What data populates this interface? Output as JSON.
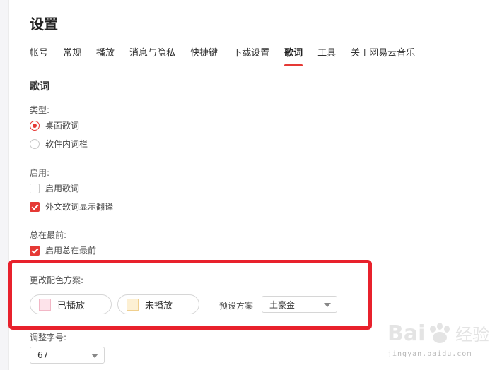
{
  "settings": {
    "title": "设置",
    "tabs": [
      {
        "label": "帐号"
      },
      {
        "label": "常规"
      },
      {
        "label": "播放"
      },
      {
        "label": "消息与隐私"
      },
      {
        "label": "快捷键"
      },
      {
        "label": "下载设置"
      },
      {
        "label": "歌词",
        "active": true
      },
      {
        "label": "工具"
      },
      {
        "label": "关于网易云音乐"
      }
    ]
  },
  "lyrics": {
    "section_title": "歌词",
    "type": {
      "label": "类型:",
      "options": [
        {
          "label": "桌面歌词",
          "checked": true
        },
        {
          "label": "软件内词栏",
          "checked": false
        }
      ]
    },
    "enable": {
      "label": "启用:",
      "options": [
        {
          "label": "启用歌词",
          "checked": false
        },
        {
          "label": "外文歌词显示翻译",
          "checked": true
        }
      ]
    },
    "always_on_top": {
      "label": "总在最前:",
      "option": {
        "label": "启用总在最前",
        "checked": true
      }
    },
    "color_scheme": {
      "label": "更改配色方案:",
      "played": {
        "label": "已播放",
        "color": "#fde3ea"
      },
      "unplayed": {
        "label": "未播放",
        "color": "#fdf0d3"
      },
      "preset_label": "预设方案",
      "preset_value": "土豪金"
    },
    "font_size": {
      "label": "调整字号:",
      "value": "67"
    }
  },
  "watermark": {
    "brand": "Baidu 经验",
    "url": "jingyan.baidu.com"
  },
  "colors": {
    "accent": "#e53935",
    "highlight_box": "#e8212c"
  }
}
